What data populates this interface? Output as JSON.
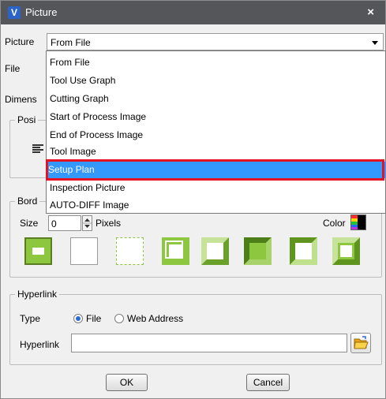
{
  "window": {
    "title": "Picture",
    "close": "×"
  },
  "picture": {
    "label": "Picture",
    "value": "From File"
  },
  "file_label": "File",
  "dimensions_label": "Dimens",
  "position_label": "Posi",
  "border": {
    "label": "Bord",
    "size_label": "Size",
    "size_value": "0",
    "pixels_label": "Pixels",
    "color_label": "Color",
    "styles": [
      "solid",
      "none",
      "dotted",
      "double",
      "groove",
      "ridge",
      "inset",
      "outset"
    ]
  },
  "dropdown": {
    "options": [
      "From File",
      "Tool Use Graph",
      "Cutting Graph",
      "Start of Process Image",
      "End of Process Image",
      "Tool Image",
      "Setup Plan",
      "Inspection Picture",
      "AUTO-DIFF Image"
    ],
    "selected": "Setup Plan"
  },
  "hyperlink": {
    "group_label": "Hyperlink",
    "type_label": "Type",
    "option_file": "File",
    "option_web": "Web Address",
    "selected": "File",
    "field_label": "Hyperlink",
    "value": ""
  },
  "buttons": {
    "ok": "OK",
    "cancel": "Cancel"
  },
  "colors": {
    "accent": "#3399ff",
    "highlight_border": "#e81123",
    "tile_green": "#8dc63f"
  }
}
